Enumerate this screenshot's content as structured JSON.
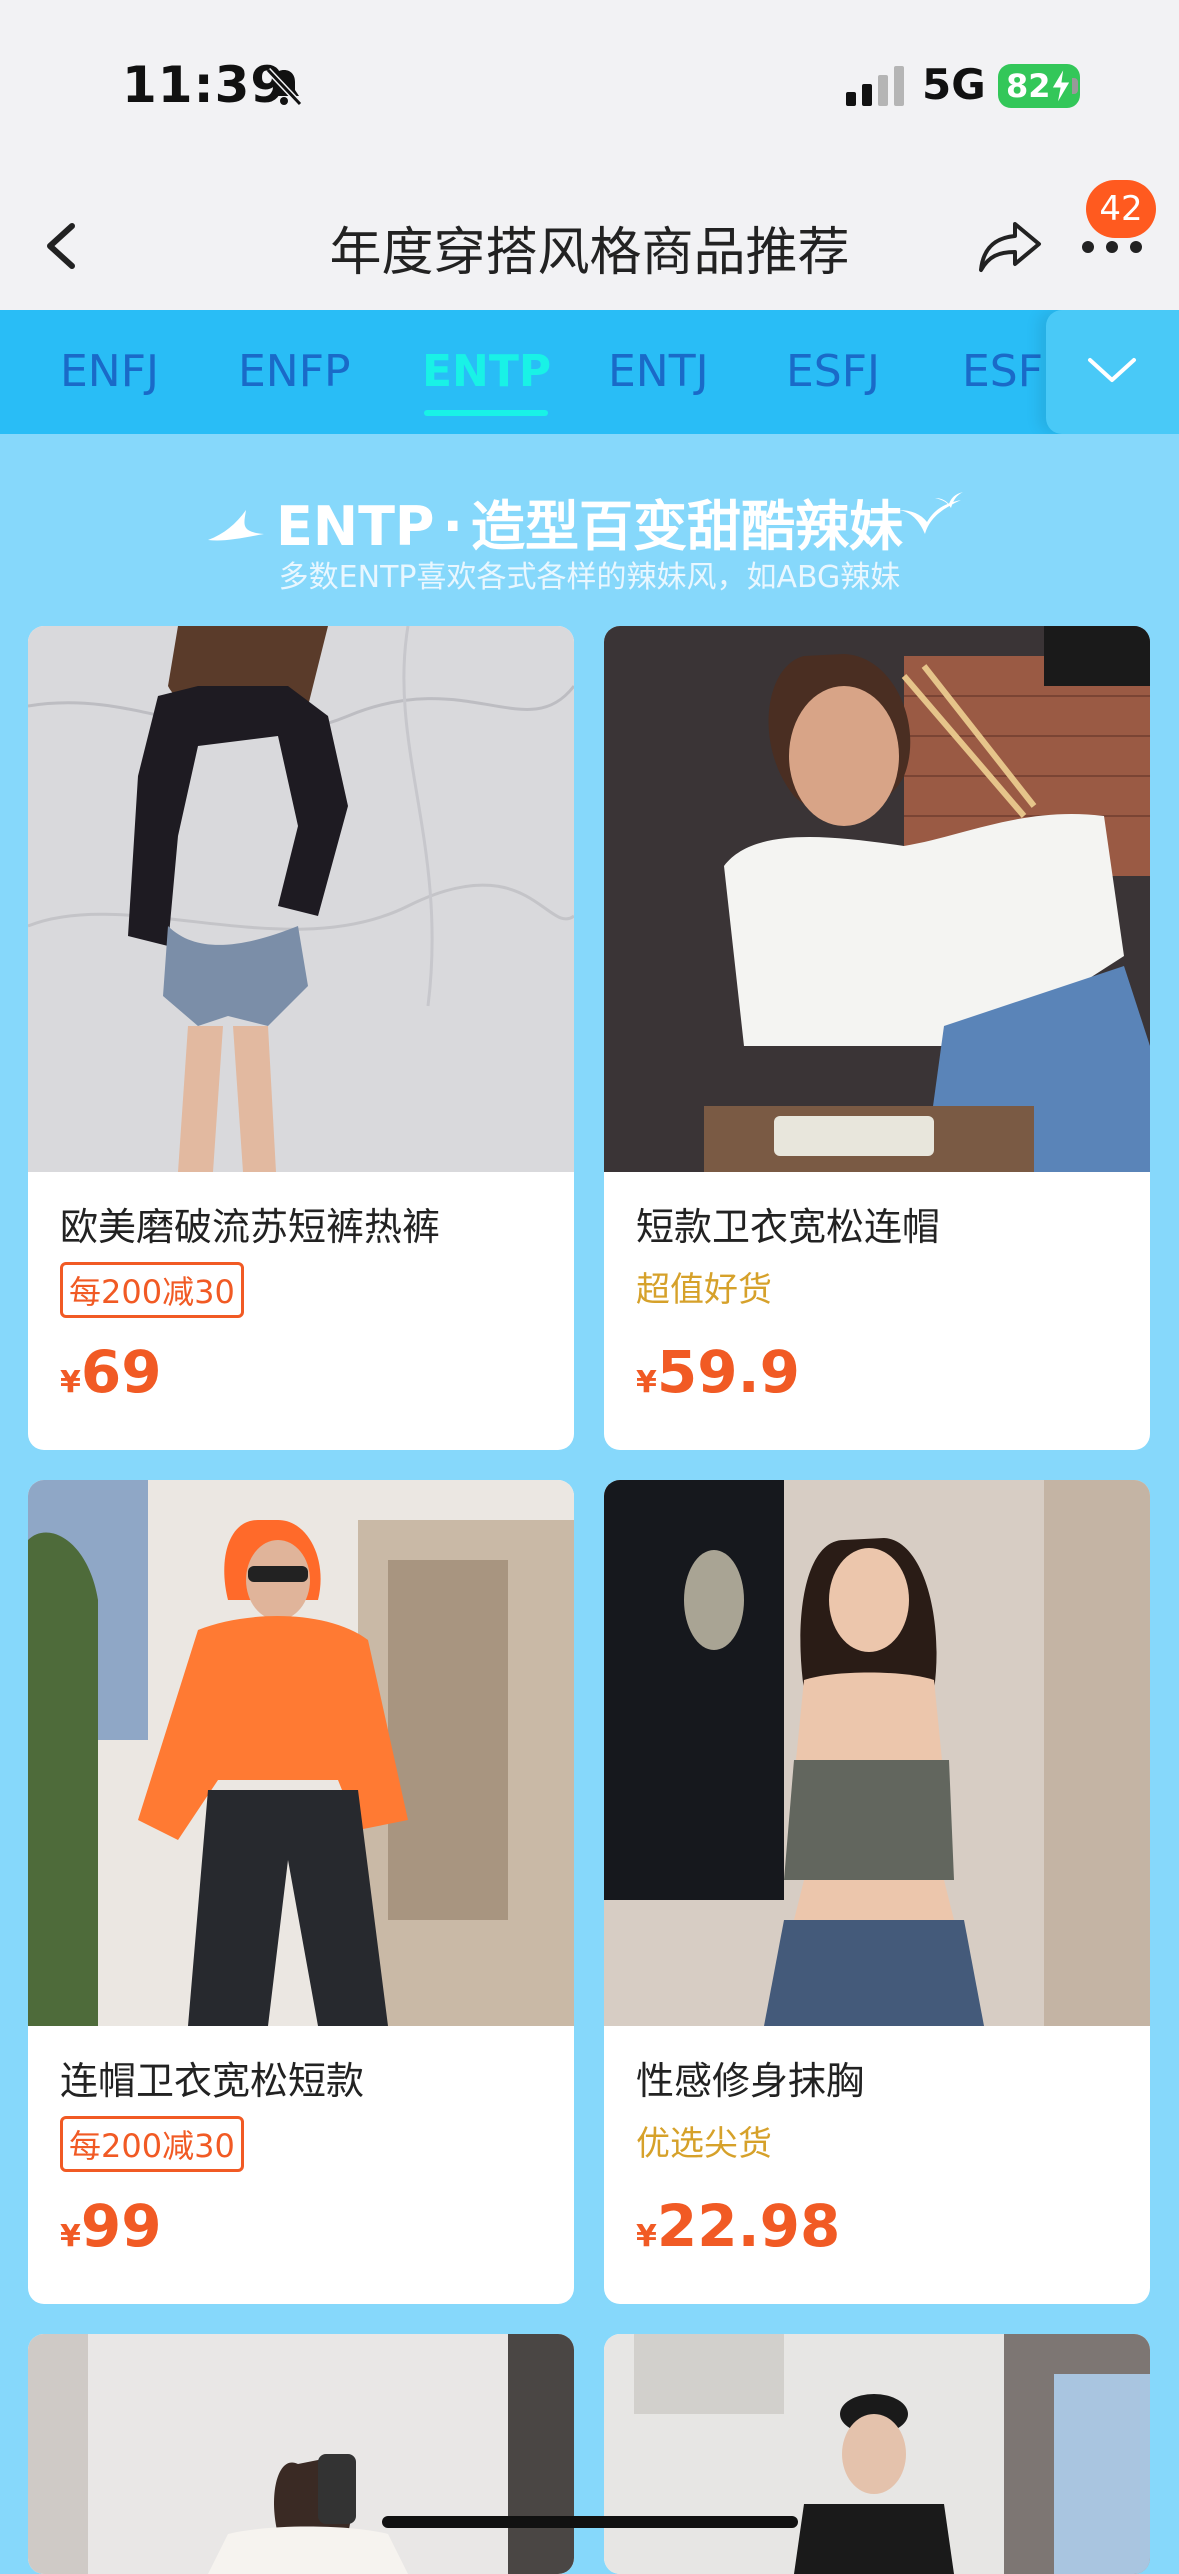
{
  "status": {
    "time": "11:39",
    "network": "5G",
    "battery": "82"
  },
  "header": {
    "title": "年度穿搭风格商品推荐",
    "badge": "42"
  },
  "tabs": [
    {
      "label": "ENFJ"
    },
    {
      "label": "ENFP"
    },
    {
      "label": "ENTP"
    },
    {
      "label": "ENTJ"
    },
    {
      "label": "ESFJ"
    },
    {
      "label": "ESF"
    }
  ],
  "active_tab": "ENTP",
  "banner": {
    "type": "ENTP",
    "dot": "·",
    "headline": "造型百变甜酷辣妹",
    "subtitle": "多数ENTP喜欢各式各样的辣妹风，如ABG辣妹"
  },
  "products": [
    {
      "name": "欧美磨破流苏短裤热裤",
      "promo": "每200减30",
      "tag": "",
      "currency": "¥",
      "price": "69"
    },
    {
      "name": "短款卫衣宽松连帽",
      "promo": "",
      "tag": "超值好货",
      "currency": "¥",
      "price": "59.9"
    },
    {
      "name": "连帽卫衣宽松短款",
      "promo": "每200减30",
      "tag": "",
      "currency": "¥",
      "price": "99"
    },
    {
      "name": "性感修身抹胸",
      "promo": "",
      "tag": "优选尖货",
      "currency": "¥",
      "price": "22.98"
    }
  ],
  "colors": {
    "background": "#86d8fb",
    "tab_bar": "#29bdf6",
    "tab_active": "#19f2e6",
    "tab_inactive": "#1a6ac8",
    "price": "#f15a24",
    "tag_gold": "#d6a12a",
    "badge": "#ff5a1f"
  }
}
